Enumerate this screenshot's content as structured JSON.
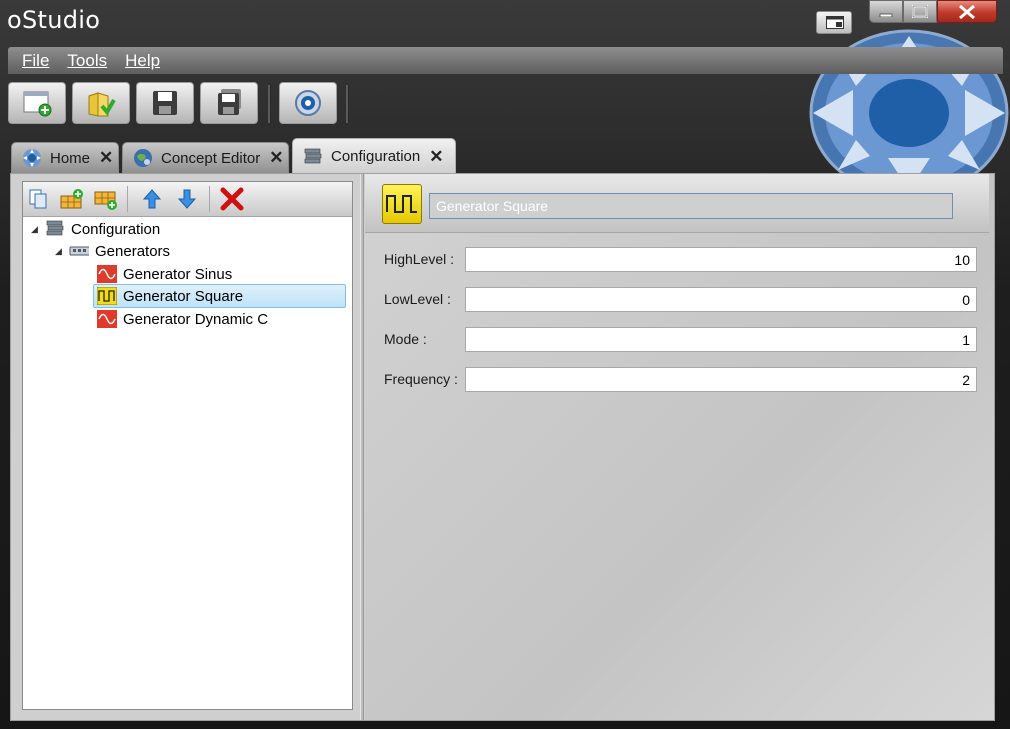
{
  "app": {
    "title": "oStudio"
  },
  "menu": [
    {
      "label": "File"
    },
    {
      "label": "Tools"
    },
    {
      "label": "Help"
    }
  ],
  "toolbar": {
    "buttons": [
      {
        "icon": "new-document-icon"
      },
      {
        "icon": "open-folder-icon"
      },
      {
        "icon": "save-icon"
      },
      {
        "icon": "save-all-icon"
      },
      {
        "icon": "settings-icon"
      }
    ]
  },
  "tabs": [
    {
      "label": "Home",
      "icon": "home-icon",
      "active": false
    },
    {
      "label": "Concept Editor",
      "icon": "globe-icon",
      "active": false
    },
    {
      "label": "Configuration",
      "icon": "configuration-icon",
      "active": true
    }
  ],
  "tree": {
    "toolbar": [
      {
        "icon": "copy-icon"
      },
      {
        "icon": "add-group-icon"
      },
      {
        "icon": "add-item-icon"
      },
      {
        "icon": "move-up-icon"
      },
      {
        "icon": "move-down-icon"
      },
      {
        "icon": "delete-icon"
      }
    ],
    "root": {
      "label": "Configuration",
      "icon": "configuration-icon"
    },
    "group": {
      "label": "Generators",
      "icon": "generators-icon"
    },
    "items": [
      {
        "label": "Generator Sinus",
        "icon": "sine-wave-icon",
        "selected": false
      },
      {
        "label": "Generator Square",
        "icon": "square-wave-icon",
        "selected": true
      },
      {
        "label": "Generator Dynamic C",
        "icon": "sine-wave-icon",
        "selected": false
      }
    ]
  },
  "detail": {
    "name": "Generator Square",
    "icon": "square-wave-icon",
    "properties": [
      {
        "label": "HighLevel :",
        "value": "10"
      },
      {
        "label": "LowLevel :",
        "value": "0"
      },
      {
        "label": "Mode :",
        "value": "1"
      },
      {
        "label": "Frequency :",
        "value": "2"
      }
    ]
  },
  "colors": {
    "accent": "#1e5fa8",
    "selection": "#bfe2f8",
    "delete": "#d01010",
    "generator_yellow": "#f2dc1a",
    "generator_red": "#e03a2a"
  }
}
